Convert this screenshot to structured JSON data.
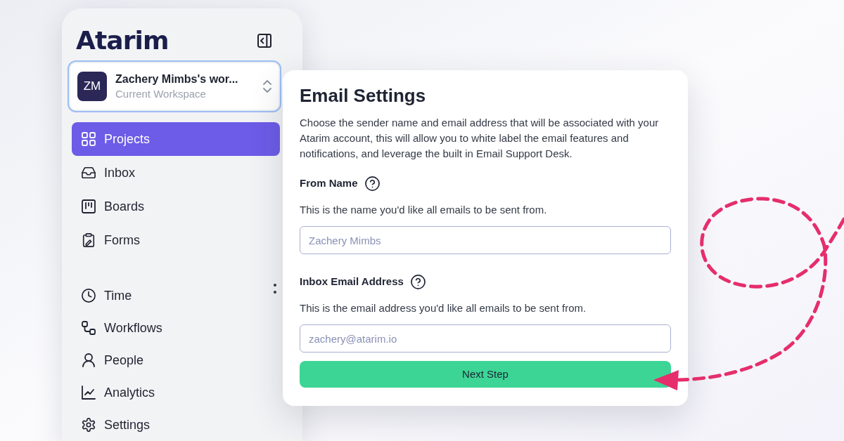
{
  "sidebar": {
    "logo": "Atarim",
    "workspace": {
      "avatar_initials": "ZM",
      "name": "Zachery Mimbs's wor...",
      "subtitle": "Current Workspace"
    },
    "nav_sections": [
      {
        "items": [
          {
            "label": "Projects",
            "selected": true
          },
          {
            "label": "Inbox",
            "selected": false
          },
          {
            "label": "Boards",
            "selected": false
          },
          {
            "label": "Forms",
            "selected": false
          }
        ]
      },
      {
        "items": [
          {
            "label": "Time",
            "selected": false
          },
          {
            "label": "Workflows",
            "selected": false
          },
          {
            "label": "People",
            "selected": false
          },
          {
            "label": "Analytics",
            "selected": false
          },
          {
            "label": "Settings",
            "selected": false
          }
        ]
      }
    ]
  },
  "email_settings": {
    "title": "Email Settings",
    "description": "Choose the sender name and email address that will be associated with your Atarim account, this will allow you to white label the email features and notifications, and leverage the built in Email Support Desk.",
    "fields": [
      {
        "label": "From Name",
        "help": "This is the name you'd like all emails to be sent from.",
        "placeholder": "Zachery Mimbs"
      },
      {
        "label": "Inbox Email Address",
        "help": "This is the email address you'd like all emails to be sent from.",
        "placeholder": "zachery@atarim.io"
      }
    ],
    "button": "Next Step"
  }
}
